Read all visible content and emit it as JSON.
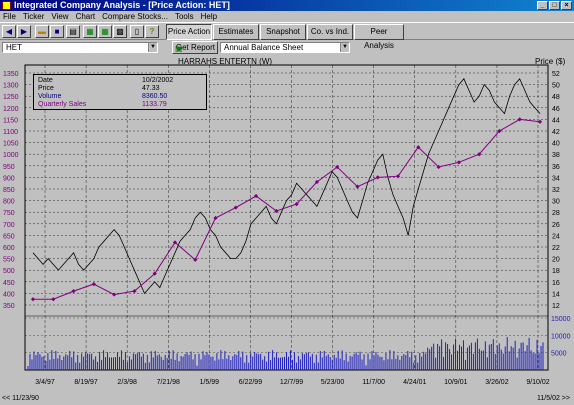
{
  "window": {
    "title": "Integrated Company Analysis - [Price Action:  HET]",
    "min_glyph": "_",
    "max_glyph": "□",
    "close_glyph": "×"
  },
  "menu": [
    "File",
    "Ticker",
    "View",
    "Chart",
    "Compare Stocks...",
    "Tools",
    "Help"
  ],
  "tabs": {
    "price_action": "Price Action",
    "estimates": "Estimates",
    "snapshot": "Snapshot",
    "co_vs_ind": "Co. vs Ind.",
    "peer_analysis": "Peer Analysis"
  },
  "controls": {
    "ticker_value": "HET",
    "get_report": "Get Report",
    "report_value": "Annual Balance Sheet"
  },
  "icons": {
    "back": "back-arrow-icon",
    "forward": "forward-arrow-icon",
    "open": "open-folder-icon",
    "save": "save-icon",
    "print": "printer-icon",
    "grid1": "table-icon",
    "grid2": "table-icon",
    "grid3": "chart-grid-icon",
    "report": "document-icon",
    "help": "help-icon"
  },
  "info": {
    "date_label": "Date",
    "date_value": "10/2/2002",
    "price_label": "Price",
    "price_value": "47.33",
    "volume_label": "Volume",
    "volume_value": "8360.50",
    "sales_label": "Quarterly Sales",
    "sales_value": "1133.79"
  },
  "chart_data": {
    "type": "line",
    "title": "HARRAHS ENTERTN (W)",
    "right_axis_title": "Price ($)",
    "left_ticks": [
      1350,
      1300,
      1250,
      1200,
      1150,
      1100,
      1050,
      1000,
      950,
      900,
      850,
      800,
      750,
      700,
      650,
      600,
      550,
      500,
      450,
      400,
      350
    ],
    "right_ticks": [
      52,
      50,
      48,
      46,
      44,
      42,
      40,
      38,
      36,
      34,
      32,
      30,
      28,
      26,
      24,
      22,
      20,
      18,
      16,
      14,
      12
    ],
    "volume_ticks": [
      15000,
      10000,
      5000
    ],
    "x_ticks": [
      "3/4/97",
      "8/19/97",
      "2/3/98",
      "7/21/98",
      "1/5/99",
      "6/22/99",
      "12/7/99",
      "5/23/00",
      "11/7/00",
      "4/24/01",
      "10/9/01",
      "3/26/02",
      "9/10/02"
    ],
    "range_start": "<< 11/23/90",
    "range_end": "11/5/02 >>",
    "colors": {
      "price": "#000000",
      "sales": "#800080",
      "volume": "#2020c0",
      "accent": "#000080"
    },
    "series": [
      {
        "name": "Price",
        "axis": "right",
        "t": [
          0,
          2,
          4,
          6,
          8,
          10,
          12,
          14,
          16,
          18,
          20,
          22,
          24,
          26,
          28,
          30,
          32,
          34,
          36,
          38,
          40,
          42,
          44,
          46,
          48,
          50,
          52,
          54,
          56,
          58,
          60,
          62,
          64,
          66,
          68,
          70,
          72,
          74,
          76,
          78,
          80,
          82,
          84,
          86,
          88,
          90,
          92,
          94,
          96,
          98,
          100,
          102,
          104,
          106,
          108,
          110,
          112,
          114,
          116,
          118,
          120,
          122,
          124,
          126,
          128,
          130,
          132,
          134,
          136,
          138,
          140,
          142,
          144,
          146,
          148,
          150,
          152,
          154,
          156,
          158,
          160,
          162,
          164,
          166,
          168,
          170,
          172,
          174,
          176,
          178,
          180,
          182,
          184,
          186,
          188,
          190,
          192,
          194,
          196,
          198,
          200
        ],
        "values": [
          21,
          20,
          19,
          20,
          19,
          18,
          19,
          20,
          21,
          19,
          18,
          19,
          20,
          22,
          23,
          24,
          25,
          24,
          22,
          20,
          18,
          16,
          14,
          15,
          16,
          15,
          17,
          19,
          21,
          23,
          24,
          25,
          27,
          28,
          27,
          25,
          24,
          22,
          21,
          20,
          20,
          21,
          23,
          26,
          27,
          28,
          29,
          27,
          26,
          28,
          30,
          31,
          33,
          32,
          31,
          30,
          29,
          31,
          33,
          35,
          34,
          32,
          30,
          28,
          27,
          30,
          33,
          35,
          37,
          38,
          34,
          31,
          29,
          27,
          24,
          29,
          32,
          35,
          38,
          40,
          42,
          44,
          46,
          48,
          50,
          51,
          49,
          47,
          48,
          50,
          49,
          47,
          46,
          45,
          48,
          50,
          51,
          49,
          47,
          46,
          45
        ]
      },
      {
        "name": "Quarterly Sales",
        "axis": "left",
        "t": [
          0,
          8,
          16,
          24,
          32,
          40,
          48,
          56,
          64,
          72,
          80,
          88,
          96,
          104,
          112,
          120,
          128,
          136,
          144,
          152,
          160,
          168,
          176,
          184,
          192,
          200
        ],
        "values": [
          375,
          375,
          410,
          440,
          395,
          410,
          485,
          620,
          545,
          725,
          770,
          820,
          755,
          785,
          880,
          945,
          860,
          900,
          905,
          1030,
          945,
          965,
          1000,
          1100,
          1150,
          1140
        ]
      }
    ],
    "ylim_left": [
      350,
      1350
    ],
    "ylim_right": [
      12,
      52
    ],
    "volume_label": "Volume",
    "volume_ylim": [
      0,
      15000
    ]
  }
}
